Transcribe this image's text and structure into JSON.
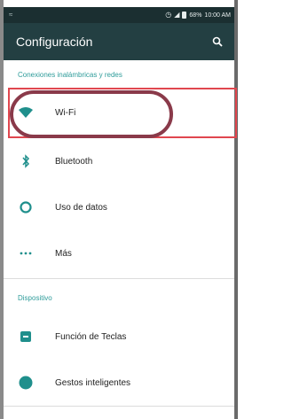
{
  "status_bar": {
    "left_icon": "signal-icon",
    "battery_percent": "68%",
    "time": "10:00 AM"
  },
  "app_bar": {
    "title": "Configuración",
    "search_icon": "search-icon"
  },
  "sections": {
    "wireless": {
      "header": "Conexiones inalámbricas y redes",
      "items": [
        {
          "label": "Wi-Fi",
          "icon": "wifi-icon"
        },
        {
          "label": "Bluetooth",
          "icon": "bluetooth-icon"
        },
        {
          "label": "Uso de datos",
          "icon": "data-usage-icon"
        },
        {
          "label": "Más",
          "icon": "more-icon"
        }
      ]
    },
    "device": {
      "header": "Dispositivo",
      "items": [
        {
          "label": "Función de Teclas",
          "icon": "keys-icon"
        },
        {
          "label": "Gestos inteligentes",
          "icon": "gestures-icon"
        }
      ]
    }
  },
  "colors": {
    "accent": "#2e9c9a",
    "app_bar": "#233f42",
    "status_bar": "#1b2f31",
    "highlight_box": "#e0474f",
    "highlight_oval": "#8a3a4a"
  }
}
